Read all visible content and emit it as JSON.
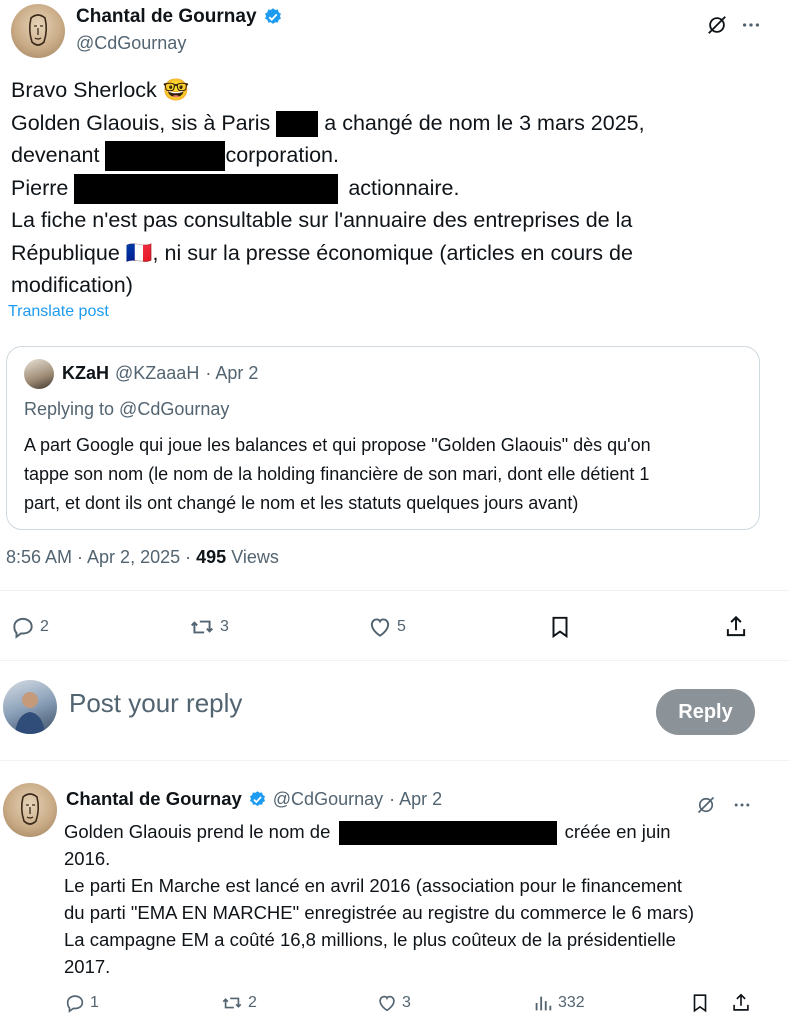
{
  "main_post": {
    "author_name": "Chantal de Gournay",
    "author_handle": "@CdGournay",
    "text": {
      "l1": "Bravo Sherlock",
      "l1_emoji": "🤓",
      "l2a": "Golden Glaouis, sis à Paris",
      "l2b": "a changé de nom le 3 mars 2025,",
      "l3a": "devenant",
      "l3b": "corporation.",
      "l4a": "Pierre",
      "l4b": "actionnaire.",
      "l5": "La fiche n'est pas consultable sur l'annuaire des entreprises de la",
      "l6a": "République",
      "l6_emoji": "🇫🇷",
      "l6b": ", ni sur la presse économique (articles en cours de",
      "l7": "modification)"
    },
    "translate_label": "Translate post",
    "quote": {
      "author_name": "KZaH",
      "author_handle": "@KZaaaH",
      "date": "· Apr 2",
      "replying_to": "Replying to @CdGournay",
      "lines": [
        "A part Google qui joue les balances et qui propose \"Golden Glaouis\" dès qu'on",
        "tappe son nom (le nom de la holding financière de son mari, dont elle détient 1",
        "part, et dont ils ont changé le nom et les statuts quelques jours avant)"
      ]
    },
    "time": "8:56 AM · Apr 2, 2025 ·",
    "views_count": "495",
    "views_label": "Views",
    "counts": {
      "replies": "2",
      "reposts": "3",
      "likes": "5"
    }
  },
  "composer": {
    "placeholder": "Post your reply",
    "button_label": "Reply"
  },
  "reply_post": {
    "author_name": "Chantal de Gournay",
    "author_handle": "@CdGournay",
    "date": "· Apr 2",
    "text": {
      "l1a": "Golden Glaouis prend le nom de",
      "l1b": "créée en juin",
      "l2": "2016.",
      "l3": "Le parti En Marche est lancé en avril 2016 (association pour le financement",
      "l4": "du parti \"EMA EN MARCHE\" enregistrée au registre du commerce le 6 mars)",
      "l5": "La campagne EM a coûté 16,8 millions, le plus coûteux de la présidentielle",
      "l6": "2017."
    },
    "counts": {
      "replies": "1",
      "reposts": "2",
      "likes": "3",
      "views": "332"
    }
  },
  "colors": {
    "accent": "#1d9bf0",
    "verified": "#1d9bf0",
    "muted": "#536471",
    "reply_button": "#8b9298"
  }
}
